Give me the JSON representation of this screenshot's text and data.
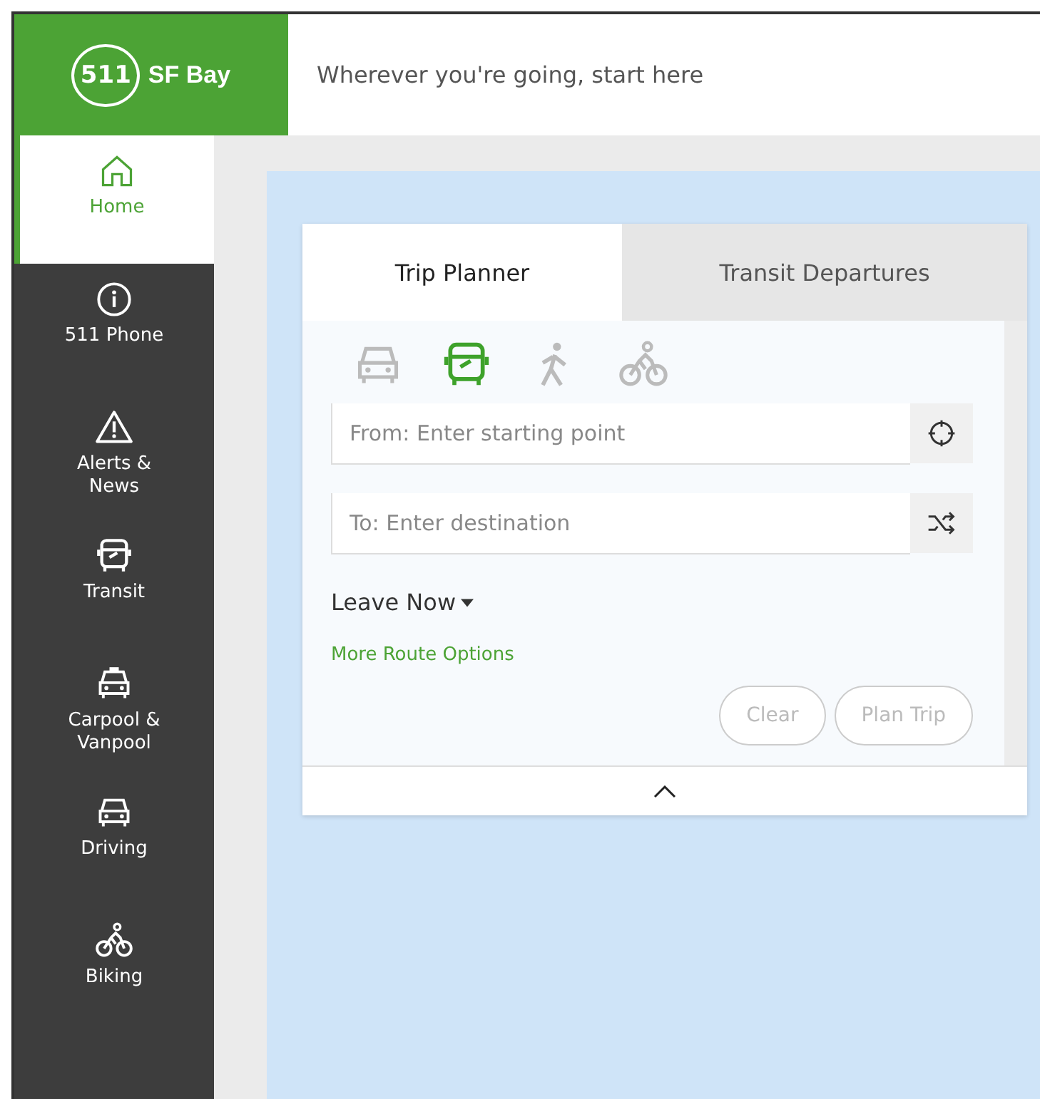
{
  "header": {
    "logo_number": "511",
    "logo_text": "SF Bay",
    "tagline": "Wherever you're going, start here"
  },
  "sidebar": {
    "items": [
      {
        "kind": "home",
        "label": "Home",
        "selected": true
      },
      {
        "kind": "info",
        "label": "511 Phone",
        "selected": false
      },
      {
        "kind": "alert",
        "label": "Alerts &\nNews",
        "selected": false
      },
      {
        "kind": "bus",
        "label": "Transit",
        "selected": false
      },
      {
        "kind": "taxi",
        "label": "Carpool &\nVanpool",
        "selected": false
      },
      {
        "kind": "car",
        "label": "Driving",
        "selected": false
      },
      {
        "kind": "bike",
        "label": "Biking",
        "selected": false
      }
    ]
  },
  "panel": {
    "tabs": [
      {
        "label": "Trip Planner",
        "selected": true
      },
      {
        "label": "Transit Departures",
        "selected": false
      }
    ],
    "modes": [
      {
        "kind": "car",
        "selected": false
      },
      {
        "kind": "bus",
        "selected": true
      },
      {
        "kind": "walk",
        "selected": false
      },
      {
        "kind": "bike",
        "selected": false
      }
    ],
    "from": {
      "placeholder": "From: Enter starting point"
    },
    "to": {
      "placeholder": "To: Enter destination"
    },
    "time": "Leave Now",
    "options_link": "More Route Options",
    "buttons": [
      {
        "label": "Clear",
        "disabled": true
      },
      {
        "label": "Plan Trip",
        "disabled": true
      }
    ]
  }
}
